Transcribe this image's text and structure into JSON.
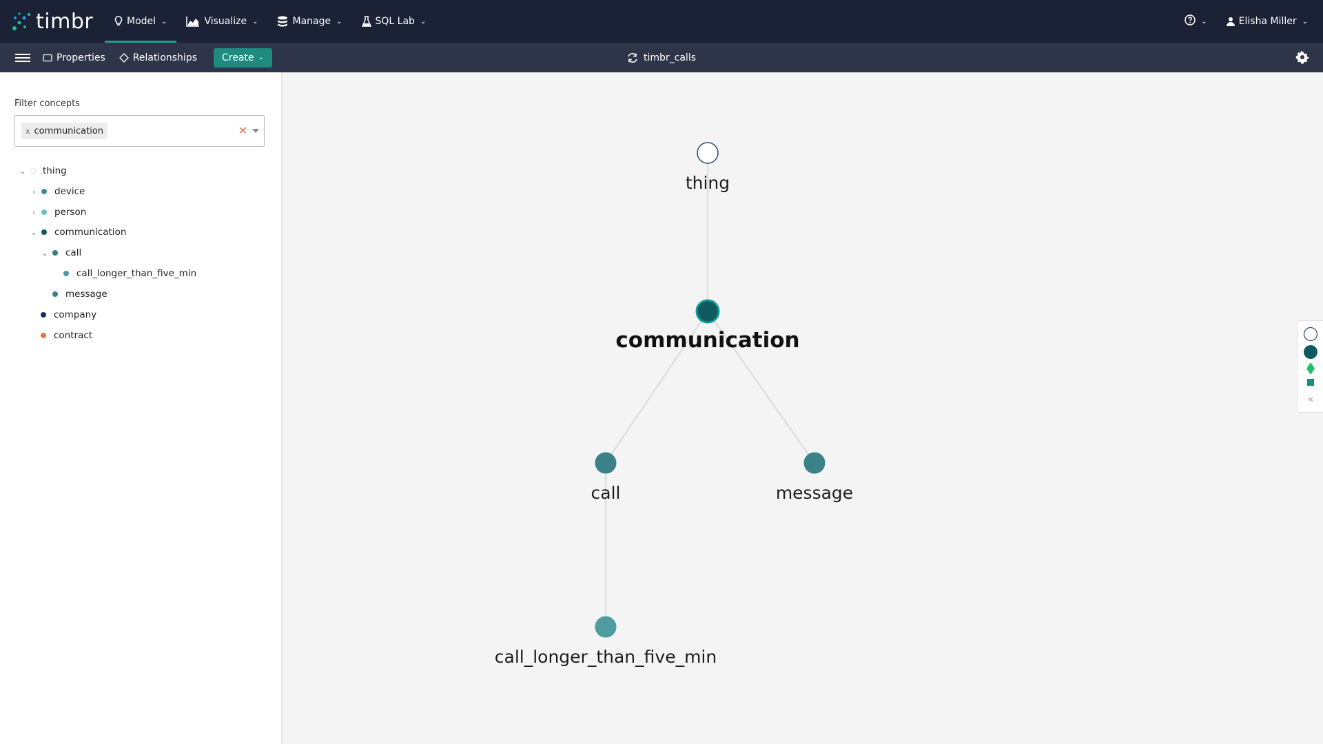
{
  "app": {
    "brand": "timbr"
  },
  "nav": {
    "items": [
      {
        "label": "Model",
        "icon": "lightbulb-icon",
        "active": true
      },
      {
        "label": "Visualize",
        "icon": "area-chart-icon",
        "active": false
      },
      {
        "label": "Manage",
        "icon": "database-icon",
        "active": false
      },
      {
        "label": "SQL Lab",
        "icon": "flask-icon",
        "active": false
      }
    ],
    "user": "Elisha Miller"
  },
  "toolbar": {
    "properties_label": "Properties",
    "relationships_label": "Relationships",
    "create_label": "Create",
    "ontology_name": "timbr_calls"
  },
  "filter": {
    "label": "Filter concepts",
    "selected": "communication",
    "chip_remove": "x"
  },
  "tree": [
    {
      "label": "thing",
      "expanded": true,
      "color": "#ffffff"
    },
    {
      "label": "device",
      "expanded": false,
      "color": "#3d8a94"
    },
    {
      "label": "person",
      "expanded": false,
      "color": "#6cc3c3"
    },
    {
      "label": "communication",
      "expanded": true,
      "color": "#0f5a5e"
    },
    {
      "label": "call",
      "expanded": true,
      "color": "#2c7e84"
    },
    {
      "label": "call_longer_than_five_min",
      "color": "#4a9aa0"
    },
    {
      "label": "message",
      "color": "#3a8288"
    },
    {
      "label": "company",
      "color": "#1b2a66"
    },
    {
      "label": "contract",
      "color": "#e8733c"
    }
  ],
  "graph": {
    "nodes": [
      {
        "id": "thing",
        "label": "thing",
        "fill": "#ffffff",
        "stroke": "#2e4a6e",
        "bold": false
      },
      {
        "id": "communication",
        "label": "communication",
        "fill": "#0f5a5e",
        "stroke": "#0d9a94",
        "bold": true
      },
      {
        "id": "call",
        "label": "call",
        "fill": "#3a8288",
        "stroke": "#3a8288",
        "bold": false
      },
      {
        "id": "message",
        "label": "message",
        "fill": "#3a8288",
        "stroke": "#3a8288",
        "bold": false
      },
      {
        "id": "call_longer_than_five_min",
        "label": "call_longer_than_five_min",
        "fill": "#4f9ba0",
        "stroke": "#4f9ba0",
        "bold": false
      }
    ],
    "edges": [
      {
        "from": "thing",
        "to": "communication"
      },
      {
        "from": "communication",
        "to": "call"
      },
      {
        "from": "communication",
        "to": "message"
      },
      {
        "from": "call",
        "to": "call_longer_than_five_min"
      }
    ]
  },
  "legend": {
    "items": [
      {
        "icon": "circle-outline-icon",
        "color": "#ffffff"
      },
      {
        "icon": "circle-filled-icon",
        "color": "#0f5a5e"
      },
      {
        "icon": "diamond-icon",
        "color": "#1fbf6a"
      },
      {
        "icon": "square-icon",
        "color": "#1e8b7f"
      }
    ]
  }
}
